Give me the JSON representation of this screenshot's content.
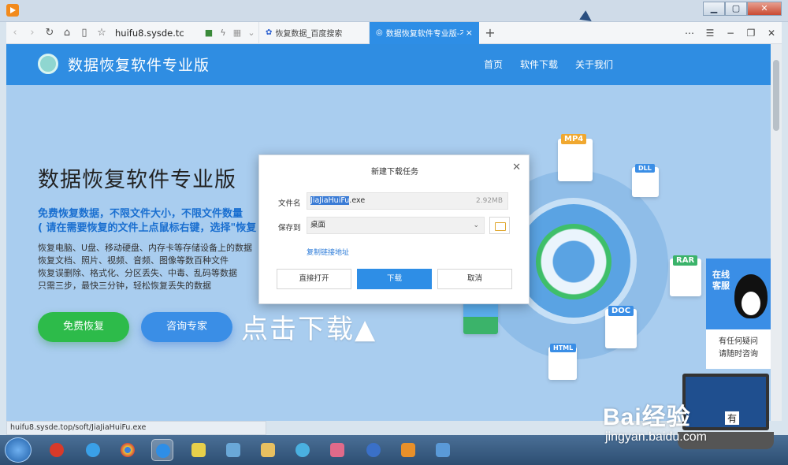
{
  "browser": {
    "url": "huifu8.sysde.tc",
    "tabs": [
      {
        "label": "恢复数据_百度搜索"
      },
      {
        "label": "数据恢复软件专业版-不花钱"
      }
    ],
    "status_url": "huifu8.sysde.top/soft/JiaJiaHuiFu.exe"
  },
  "site": {
    "logo": "数据恢复软件专业版",
    "menu": [
      "首页",
      "软件下载",
      "关于我们"
    ]
  },
  "hero": {
    "title": "数据恢复软件专业版",
    "sub1": "免费恢复数据，不限文件大小，不限文件数量",
    "sub2": "( 请在需要恢复的文件上点鼠标右键，选择\"恢复",
    "lines": [
      "恢复电脑、U盘、移动硬盘、内存卡等存储设备上的数据",
      "恢复文档、照片、视频、音频、图像等数百种文件",
      "恢复误删除、格式化、分区丢失、中毒、乱码等数据",
      "只需三步，最快三分钟，轻松恢复丢失的数据"
    ],
    "btn_free": "免费恢复",
    "btn_consult": "咨询专家",
    "click_text": "点击下载▲"
  },
  "illustration": {
    "badges": [
      "MP4",
      "DLL",
      "RAR",
      "DOC",
      "HTML"
    ]
  },
  "support": {
    "label": "在线客服",
    "line1": "有任何疑问",
    "line2": "请随时咨询"
  },
  "dialog": {
    "title": "新建下载任务",
    "filename_label": "文件名",
    "filename_sel": "JiaJiaHuiFu",
    "filename_ext": ".exe",
    "size": "2.92MB",
    "saveto_label": "保存到",
    "saveto_value": "桌面",
    "copy_link": "复制链接地址",
    "btn_open": "直接打开",
    "btn_download": "下载",
    "btn_cancel": "取消"
  },
  "watermark": {
    "brand": "Bai经验",
    "url": "jingyan.baidu.com",
    "laptop_label": "有"
  },
  "colors": {
    "accent": "#2f8de2",
    "green": "#2dbb4a",
    "page_bg": "#a9cdef"
  }
}
